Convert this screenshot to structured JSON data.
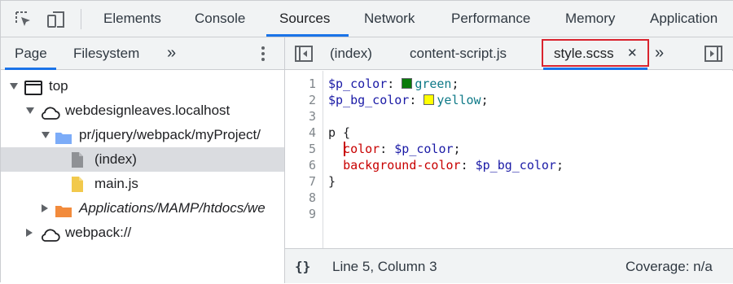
{
  "toolbar": {
    "icons": [
      "inspect-element-icon",
      "device-toolbar-icon"
    ],
    "tabs": [
      {
        "label": "Elements",
        "active": false
      },
      {
        "label": "Console",
        "active": false
      },
      {
        "label": "Sources",
        "active": true
      },
      {
        "label": "Network",
        "active": false
      },
      {
        "label": "Performance",
        "active": false
      },
      {
        "label": "Memory",
        "active": false
      },
      {
        "label": "Application",
        "active": false
      }
    ],
    "active_color": "#1a73e8"
  },
  "navigator": {
    "tabs": [
      {
        "label": "Page",
        "active": true
      },
      {
        "label": "Filesystem",
        "active": false
      }
    ],
    "more_label": "»",
    "tree": [
      {
        "label": "top",
        "icon": "frame-icon",
        "expanded": true
      },
      {
        "label": "webdesignleaves.localhost",
        "icon": "cloud-icon",
        "expanded": true
      },
      {
        "label": "pr/jquery/webpack/myProject/",
        "icon": "folder-icon",
        "expanded": true
      },
      {
        "label": "(index)",
        "icon": "file-icon",
        "selected": true
      },
      {
        "label": "main.js",
        "icon": "js-file-icon"
      },
      {
        "label": "Applications/MAMP/htdocs/we",
        "icon": "folder-icon",
        "expanded": false
      },
      {
        "label": "webpack://",
        "icon": "cloud-icon",
        "expanded": false
      }
    ]
  },
  "editor": {
    "tabs": [
      {
        "label": "(index)",
        "active": false
      },
      {
        "label": "content-script.js",
        "active": false
      },
      {
        "label": "style.scss",
        "active": true,
        "close": "✕"
      }
    ],
    "more_label": "»",
    "line_numbers": [
      "1",
      "2",
      "3",
      "4",
      "5",
      "6",
      "7",
      "8",
      "9"
    ],
    "code": {
      "l1_var": "$p_color",
      "l1_colon": ": ",
      "l1_value": "green",
      "l1_end": ";",
      "l2_var": "$p_bg_color",
      "l2_colon": ": ",
      "l2_value": "yellow",
      "l2_end": ";",
      "l4": "p {",
      "l5_prop": "color",
      "l5_colon": ": ",
      "l5_var": "$p_color",
      "l5_end": ";",
      "l6_prop": "background-color",
      "l6_colon": ": ",
      "l6_var": "$p_bg_color",
      "l6_end": ";",
      "l7": "}"
    },
    "swatch_colors": {
      "green": "#0a7a0a",
      "yellow": "#ffff00"
    }
  },
  "status": {
    "format_label": "{}",
    "position": "Line 5, Column 3",
    "coverage": "Coverage: n/a"
  }
}
